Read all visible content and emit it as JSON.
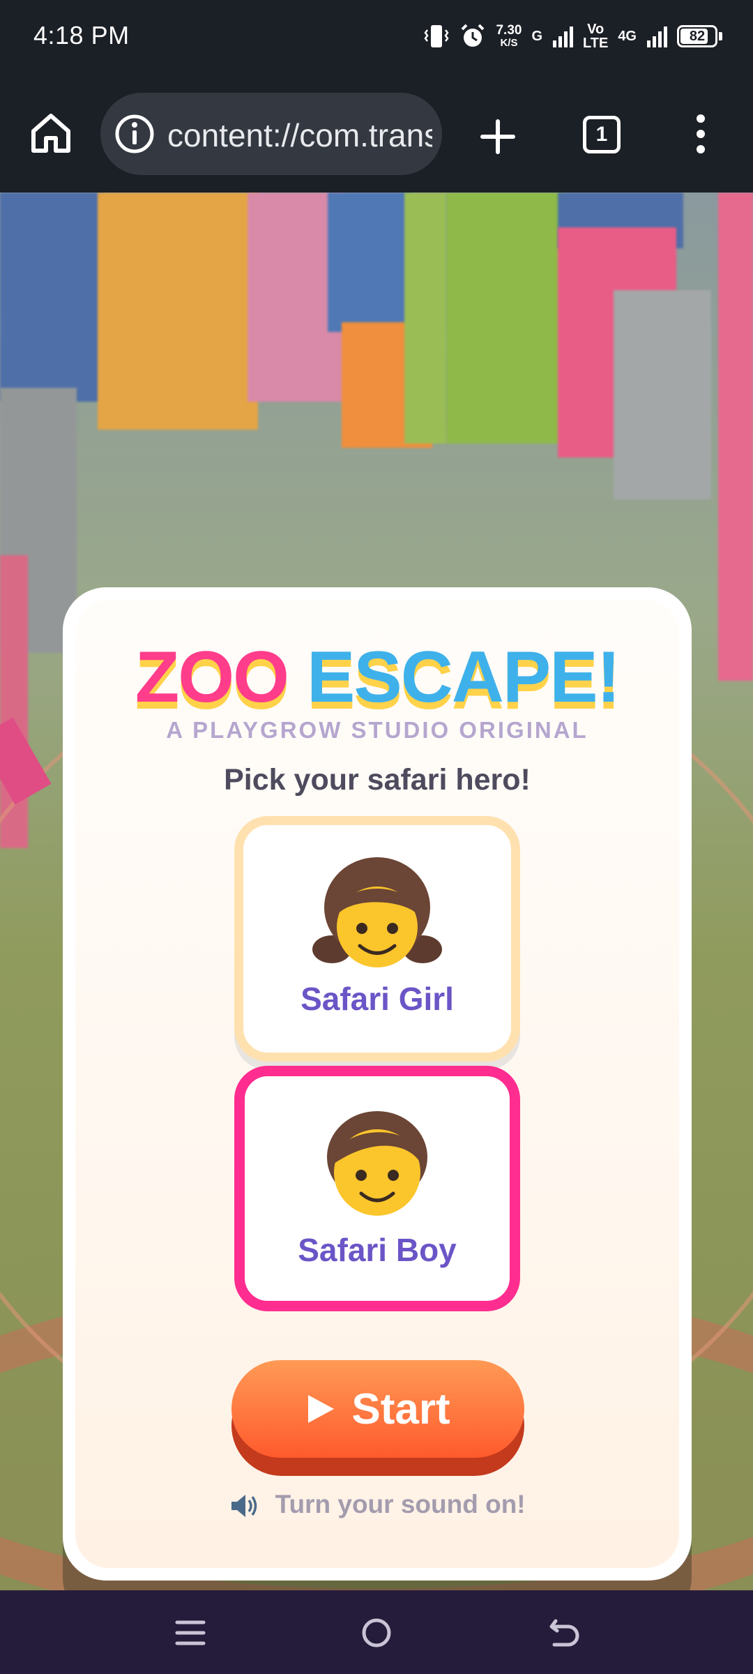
{
  "status_bar": {
    "time": "4:18 PM",
    "net_speed_value": "7.30",
    "net_speed_unit": "K/S",
    "network_g": "G",
    "volte_top": "Vo",
    "volte_bottom": "LTE",
    "network_4g": "4G",
    "battery_level": 82
  },
  "browser": {
    "url": "content://com.transsion.filemanager",
    "tab_count": "1"
  },
  "game": {
    "title_part1": "ZOO",
    "title_part2": "ESCAPE!",
    "subtitle": "A PLAYGROW STUDIO ORIGINAL",
    "prompt": "Pick your safari hero!",
    "heroes": [
      {
        "label": "Safari Girl",
        "emoji": "girl-emoji",
        "selected": false
      },
      {
        "label": "Safari Boy",
        "emoji": "boy-emoji",
        "selected": true
      }
    ],
    "start_label": "Start",
    "sound_hint": "Turn your sound on!"
  },
  "colors": {
    "title_pink": "#ff3d8b",
    "title_blue": "#3fb1ea",
    "title_shadow": "#ffd24a",
    "hero_label": "#6b55c6",
    "selected_border": "#ff2d8f",
    "unselected_border": "#ffe1b0",
    "start_button": "#ff6e3a"
  },
  "icons": {
    "home": "home-icon",
    "info": "info-icon",
    "new_tab": "plus-icon",
    "menu": "more-vert-icon",
    "speaker": "speaker-icon",
    "play": "play-icon"
  }
}
